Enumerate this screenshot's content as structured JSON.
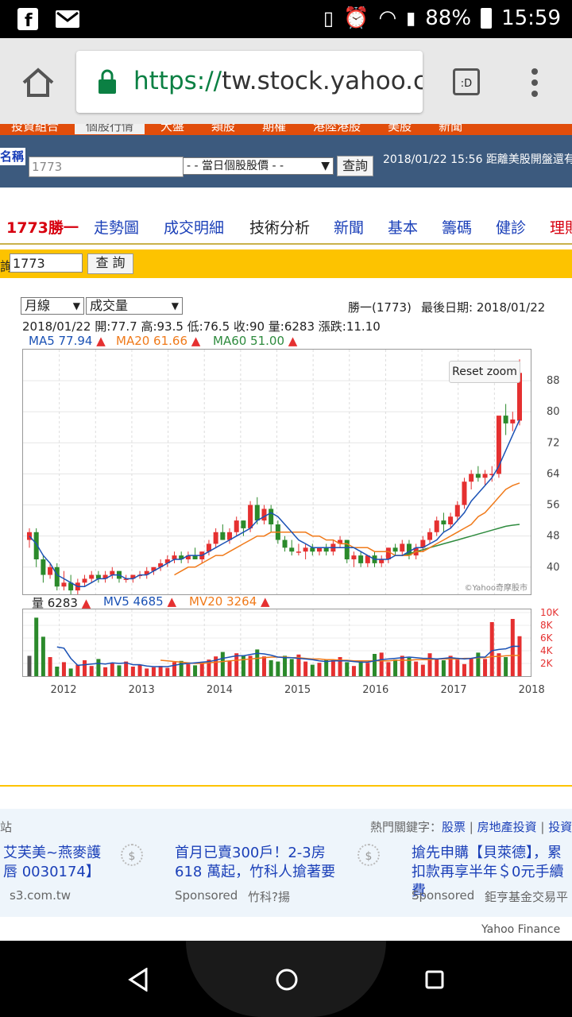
{
  "status": {
    "battery": "88%",
    "time": "15:59"
  },
  "browser": {
    "url_scheme": "https://",
    "url_host": "tw.stock.yahoo.co"
  },
  "site": {
    "tabs": [
      "投資組合",
      "個股行情",
      "大盤",
      "類股",
      "期權",
      "港陸港股",
      "美股",
      "新聞"
    ],
    "name_label": "名稱",
    "search_value": "1773",
    "select_value": "- - 當日個股股價 - -",
    "query_btn": "查詢",
    "market_notice": "2018/01/22 15:56 距離美股開盤還有",
    "nav": [
      "1773勝一",
      "走勢圖",
      "成交明細",
      "技術分析",
      "新聞",
      "基本",
      "籌碼",
      "健診",
      "理財"
    ],
    "query2_label": "詢",
    "query2_value": "1773",
    "query2_btn": "查 詢"
  },
  "chart_controls": {
    "period": "月線",
    "indicator": "成交量"
  },
  "chart_header": {
    "stock": "勝一(1773)",
    "last_date": "最後日期: 2018/01/22",
    "ohlc": "2018/01/22 開:77.7 高:93.5 低:76.5 收:90 量:6283 漲跌:11.10",
    "ma5": "MA5 77.94",
    "ma20": "MA20 61.66",
    "ma60": "MA60 51.00",
    "vol": "量 6283",
    "mv5": "MV5 4685",
    "mv20": "MV20 3264"
  },
  "reset_zoom": "Reset zoom",
  "credit": "©Yahoo奇摩股市",
  "colors": {
    "up": "#e53030",
    "down": "#2b8a2b",
    "ma5": "#1b52b5",
    "ma20": "#f07a1a",
    "ma60": "#2e8b3e"
  },
  "chart_data": {
    "type": "candlestick",
    "price_axis": {
      "ticks": [
        40,
        48,
        56,
        64,
        72,
        80,
        88
      ],
      "range": [
        33,
        96
      ]
    },
    "volume_axis": {
      "ticks": [
        "2K",
        "4K",
        "6K",
        "8K",
        "10K"
      ],
      "range": [
        0,
        10500
      ]
    },
    "x_axis_labels": [
      "2012",
      "2013",
      "2014",
      "2015",
      "2016",
      "2017",
      "2018"
    ],
    "candles": [
      [
        47,
        50,
        45,
        49
      ],
      [
        49,
        50,
        40,
        42
      ],
      [
        42,
        43,
        36,
        38
      ],
      [
        38,
        41,
        37,
        40
      ],
      [
        40,
        41,
        34,
        35
      ],
      [
        35,
        39,
        34,
        36
      ],
      [
        36,
        38,
        33,
        34
      ],
      [
        34,
        37,
        33,
        36
      ],
      [
        36,
        38,
        35,
        37
      ],
      [
        37,
        39,
        36,
        38
      ],
      [
        38,
        39,
        36,
        37
      ],
      [
        37,
        39,
        36,
        38
      ],
      [
        38,
        40,
        37,
        39
      ],
      [
        39,
        39,
        36,
        37
      ],
      [
        37,
        38,
        36,
        37
      ],
      [
        37,
        38,
        36,
        38
      ],
      [
        38,
        39,
        37,
        38
      ],
      [
        38,
        40,
        37,
        39
      ],
      [
        39,
        40,
        38,
        40
      ],
      [
        40,
        42,
        39,
        41
      ],
      [
        41,
        43,
        40,
        42
      ],
      [
        42,
        44,
        41,
        43
      ],
      [
        43,
        44,
        41,
        42
      ],
      [
        42,
        44,
        41,
        43
      ],
      [
        43,
        45,
        42,
        42
      ],
      [
        42,
        44,
        41,
        44
      ],
      [
        44,
        47,
        43,
        46
      ],
      [
        46,
        50,
        45,
        49
      ],
      [
        49,
        51,
        47,
        47
      ],
      [
        47,
        50,
        46,
        49
      ],
      [
        49,
        53,
        48,
        52
      ],
      [
        52,
        52,
        48,
        50
      ],
      [
        50,
        57,
        49,
        56
      ],
      [
        56,
        58,
        51,
        52
      ],
      [
        52,
        56,
        51,
        55
      ],
      [
        55,
        56,
        49,
        51
      ],
      [
        51,
        52,
        46,
        47
      ],
      [
        47,
        48,
        44,
        45
      ],
      [
        45,
        47,
        43,
        44
      ],
      [
        44,
        46,
        43,
        44
      ],
      [
        44,
        46,
        42,
        45
      ],
      [
        45,
        46,
        43,
        44
      ],
      [
        44,
        45,
        43,
        45
      ],
      [
        45,
        46,
        43,
        44
      ],
      [
        44,
        47,
        43,
        46
      ],
      [
        46,
        48,
        45,
        47
      ],
      [
        47,
        47,
        41,
        42
      ],
      [
        42,
        44,
        40,
        43
      ],
      [
        43,
        44,
        40,
        41
      ],
      [
        41,
        43,
        40,
        43
      ],
      [
        43,
        44,
        40,
        41
      ],
      [
        41,
        43,
        40,
        42
      ],
      [
        42,
        45,
        41,
        45
      ],
      [
        45,
        46,
        43,
        44
      ],
      [
        44,
        47,
        43,
        46
      ],
      [
        46,
        47,
        42,
        43
      ],
      [
        43,
        46,
        42,
        45
      ],
      [
        45,
        48,
        44,
        47
      ],
      [
        47,
        50,
        46,
        49
      ],
      [
        49,
        53,
        48,
        52
      ],
      [
        52,
        54,
        49,
        51
      ],
      [
        51,
        54,
        50,
        53
      ],
      [
        53,
        57,
        52,
        56
      ],
      [
        56,
        63,
        55,
        62
      ],
      [
        62,
        65,
        60,
        64
      ],
      [
        64,
        66,
        62,
        63
      ],
      [
        63,
        65,
        61,
        64
      ],
      [
        64,
        66,
        62,
        64
      ],
      [
        64,
        72,
        63,
        79
      ],
      [
        79,
        82,
        74,
        77
      ],
      [
        77,
        80,
        75,
        78
      ],
      [
        77.7,
        93.5,
        76.5,
        90
      ]
    ],
    "ma5": [
      48,
      46,
      43,
      41,
      38,
      37,
      36,
      35,
      35,
      36,
      37,
      37,
      38,
      38,
      37,
      37,
      38,
      38,
      39,
      40,
      41,
      42,
      42,
      43,
      43,
      43,
      44,
      45,
      46,
      47,
      48,
      49,
      50,
      52,
      53,
      54,
      53,
      51,
      49,
      47,
      46,
      45,
      45,
      45,
      45,
      45,
      45,
      45,
      44,
      43,
      42,
      42,
      42,
      43,
      43,
      44,
      45,
      45,
      46,
      47,
      49,
      50,
      52,
      54,
      57,
      59,
      61,
      63,
      66,
      70,
      74,
      77.94
    ],
    "ma20": [
      null,
      null,
      null,
      null,
      null,
      null,
      null,
      null,
      null,
      null,
      null,
      null,
      null,
      null,
      null,
      null,
      null,
      null,
      null,
      null,
      null,
      38,
      39,
      40,
      40,
      41,
      42,
      43,
      43,
      44,
      45,
      46,
      47,
      48,
      48,
      49,
      49,
      49,
      49,
      49,
      49,
      48,
      48,
      47,
      47,
      46,
      46,
      45,
      45,
      45,
      44,
      44,
      44,
      43,
      43,
      43,
      44,
      44,
      45,
      46,
      47,
      48,
      49,
      50,
      51,
      53,
      54,
      56,
      58,
      60,
      61,
      61.66
    ],
    "ma60": [
      null,
      null,
      null,
      null,
      null,
      null,
      null,
      null,
      null,
      null,
      null,
      null,
      null,
      null,
      null,
      null,
      null,
      null,
      null,
      null,
      null,
      null,
      null,
      null,
      null,
      null,
      null,
      null,
      null,
      null,
      null,
      null,
      null,
      null,
      null,
      null,
      null,
      null,
      null,
      null,
      null,
      null,
      null,
      null,
      null,
      null,
      null,
      null,
      null,
      null,
      null,
      null,
      null,
      null,
      43,
      43.5,
      44,
      44.5,
      45,
      45.5,
      46,
      46.5,
      47,
      47.5,
      48,
      48.5,
      49,
      49.5,
      50,
      50.5,
      50.8,
      51
    ],
    "volume": [
      3200,
      9200,
      6200,
      3000,
      1500,
      2200,
      1200,
      1800,
      2500,
      1600,
      2700,
      1400,
      2100,
      1700,
      2300,
      1500,
      1800,
      1200,
      1400,
      1600,
      1300,
      2200,
      2400,
      1900,
      1700,
      2100,
      2600,
      3100,
      3800,
      2400,
      3600,
      3300,
      3200,
      4200,
      3100,
      2500,
      2300,
      3200,
      2700,
      3400,
      2300,
      1800,
      2100,
      2600,
      2500,
      3000,
      2200,
      1600,
      2500,
      2100,
      3500,
      3700,
      2200,
      2600,
      3200,
      2900,
      2300,
      1800,
      3600,
      2800,
      2500,
      3200,
      2600,
      1900,
      2800,
      3700,
      2700,
      8500,
      3600,
      3000,
      9000,
      6283
    ],
    "mv5": [
      null,
      null,
      null,
      null,
      4600,
      4400,
      2800,
      1700,
      1800,
      1900,
      2000,
      1900,
      2100,
      2000,
      2100,
      1800,
      1800,
      1600,
      1500,
      1500,
      1500,
      1700,
      1900,
      2000,
      2100,
      2200,
      2300,
      2500,
      2800,
      3000,
      3200,
      3200,
      3400,
      3600,
      3500,
      3300,
      3000,
      2900,
      2900,
      2800,
      2700,
      2600,
      2400,
      2300,
      2400,
      2400,
      2400,
      2300,
      2200,
      2200,
      2400,
      2600,
      2700,
      2800,
      2900,
      3000,
      2900,
      2800,
      2800,
      2700,
      2800,
      2900,
      2800,
      2700,
      2800,
      3000,
      3000,
      4000,
      4200,
      4300,
      4700,
      4685
    ],
    "mv20": [
      null,
      null,
      null,
      null,
      null,
      null,
      null,
      null,
      null,
      null,
      null,
      null,
      null,
      null,
      null,
      null,
      null,
      null,
      null,
      2500,
      2400,
      2300,
      2200,
      2100,
      2000,
      2000,
      2100,
      2200,
      2300,
      2400,
      2500,
      2600,
      2700,
      2800,
      2900,
      3000,
      3000,
      3000,
      2900,
      2900,
      2800,
      2700,
      2700,
      2600,
      2600,
      2500,
      2500,
      2400,
      2400,
      2400,
      2400,
      2400,
      2400,
      2500,
      2500,
      2500,
      2600,
      2600,
      2600,
      2700,
      2700,
      2700,
      2700,
      2800,
      2800,
      2900,
      2900,
      3100,
      3100,
      3200,
      3250,
      3264
    ]
  },
  "ads": {
    "site_label": "站",
    "hot_label": "熱門關鍵字：",
    "hot_links": [
      "股票",
      "房地產投資",
      "投資"
    ],
    "items": [
      {
        "title": "艾芙美~燕麥護唇 0030174】",
        "source": "s3.com.tw",
        "sponsor": ""
      },
      {
        "title": "首月已賣300戶！2-3房618 萬起，竹科人搶著要",
        "source": "竹科?揚",
        "sponsor": "Sponsored"
      },
      {
        "title": "搶先申購【貝萊德】，累 扣款再享半年＄0元手續費",
        "source": "鉅亨基金交易平",
        "sponsor": "Sponsored"
      }
    ],
    "footer": "Yahoo Finance"
  }
}
